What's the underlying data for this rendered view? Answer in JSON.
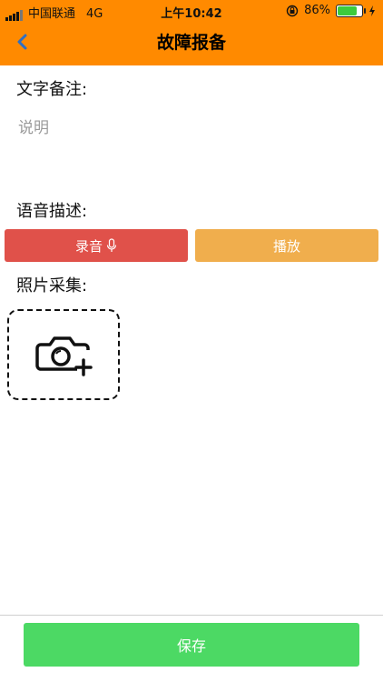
{
  "status_bar": {
    "carrier": "中国联通",
    "network": "4G",
    "time": "上午10:42",
    "battery": "86%",
    "battery_level": 0.86
  },
  "header": {
    "title": "故障报备",
    "back_icon": "chevron-left-icon"
  },
  "remark": {
    "label": "文字备注:",
    "placeholder": "说明",
    "value": ""
  },
  "voice": {
    "label": "语音描述:",
    "record_label": "录音",
    "play_label": "播放",
    "record_color": "#E0514A",
    "play_color": "#F0AE4D"
  },
  "photo": {
    "label": "照片采集:",
    "add_icon": "camera-plus-icon"
  },
  "footer": {
    "save_label": "保存",
    "save_color": "#4CD964"
  },
  "colors": {
    "header_bg": "#FF8A00"
  }
}
